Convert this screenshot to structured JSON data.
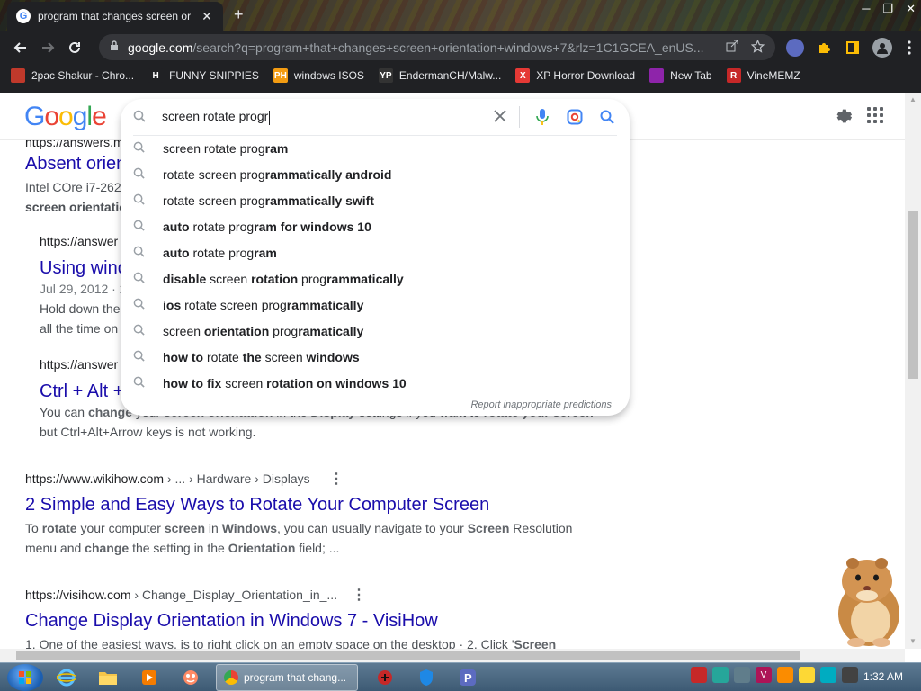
{
  "tab": {
    "title": "program that changes screen or",
    "close": "✕",
    "new_tab": "+"
  },
  "window_controls": {
    "minimize": "─",
    "maximize": "❐",
    "close": "✕"
  },
  "omnibox": {
    "host": "google.com",
    "path": "/search?q=program+that+changes+screen+orientation+windows+7&rlz=1C1GCEA_enUS..."
  },
  "bookmarks": [
    {
      "label": "2pac Shakur - Chro...",
      "icon": "2pac-bookmark-icon",
      "icon_text": "",
      "color": "#c0392b"
    },
    {
      "label": "FUNNY SNIPPIES",
      "icon": "h-icon",
      "icon_text": "H",
      "color": "#202124"
    },
    {
      "label": "windows ISOS",
      "icon": "ph-icon",
      "icon_text": "PH",
      "color": "#f39c12"
    },
    {
      "label": "EndermanCH/Malw...",
      "icon": "yp-icon",
      "icon_text": "YP",
      "color": "#333333"
    },
    {
      "label": "XP Horror Download",
      "icon": "x-icon",
      "icon_text": "X",
      "color": "#e53935"
    },
    {
      "label": "New Tab",
      "icon": "newtab-icon",
      "icon_text": "",
      "color": "#8e24aa"
    },
    {
      "label": "VineMEMZ",
      "icon": "r-icon",
      "icon_text": "R",
      "color": "#c62828"
    }
  ],
  "logo": [
    "G",
    "o",
    "o",
    "g",
    "l",
    "e"
  ],
  "search": {
    "value": "screen rotate progr",
    "report": "Report inappropriate predictions",
    "suggestions": [
      {
        "a": "screen rotate prog",
        "b": "ram",
        "c": "",
        "d": ""
      },
      {
        "a": "rotate screen prog",
        "b": "rammatically android",
        "c": "",
        "d": ""
      },
      {
        "a": "rotate screen prog",
        "b": "rammatically swift",
        "c": "",
        "d": ""
      },
      {
        "a": "",
        "b": "auto",
        "c": " rotate prog",
        "d": "ram for windows 10"
      },
      {
        "a": "",
        "b": "auto",
        "c": " rotate prog",
        "d": "ram"
      },
      {
        "a": "",
        "b": "disable",
        "c": " screen ",
        "d": "rotation",
        "e": " prog",
        "f": "rammatically"
      },
      {
        "a": "",
        "b": "ios",
        "c": " rotate screen prog",
        "d": "rammatically"
      },
      {
        "a": "screen ",
        "b": "orientation",
        "c": " prog",
        "d": "ramatically"
      },
      {
        "a": "",
        "b": "how to",
        "c": " rotate ",
        "d": "the",
        "e": " screen ",
        "f": "windows"
      },
      {
        "a": "",
        "b": "how to fix",
        "c": " screen ",
        "d": "rotation on windows 10"
      }
    ]
  },
  "results": {
    "r1_cite_partial": "https://answers.m",
    "r1_title": "Absent orien",
    "r1_snip1": "Intel COre i7-2620",
    "r1_snip2": "screen orientatio",
    "r2_cite": "https://answer",
    "r2_title": "Using wind",
    "r2_date": "Jul 29, 2012 · 2",
    "r2_snip1": "Hold down the",
    "r2_snip2": "all the time on",
    "r3_cite": "https://answer",
    "r3_title": "Ctrl + Alt +",
    "r3_snip1_pre": "You can ",
    "r3_snip1_b": "change",
    "r3_snip1_rest": " your ",
    "r3_snip1_b2": "screen orientation",
    "r3_snip1_rest2": " in the ",
    "r3_snip1_b3": "Display",
    "r3_snip1_rest3": " settings if you want to ",
    "r3_snip1_b4": "rotate your screen",
    "r3_snip2": "but Ctrl+Alt+Arrow keys is not working.",
    "r4_cite_host": "https://www.wikihow.com",
    "r4_cite_path": " › ... › Hardware › Displays",
    "r4_title": "2 Simple and Easy Ways to Rotate Your Computer Screen",
    "r4_s1": "To ",
    "r4_s1b": "rotate",
    "r4_s2": " your computer ",
    "r4_s2b": "screen",
    "r4_s3": " in ",
    "r4_s3b": "Windows",
    "r4_s4": ", you can usually navigate to your ",
    "r4_s4b": "Screen",
    "r4_s5": " Resolution",
    "r4_l2a": "menu and ",
    "r4_l2b": "change",
    "r4_l2c": " the setting in the ",
    "r4_l2d": "Orientation",
    "r4_l2e": " field; ...",
    "r5_cite_host": "https://visihow.com",
    "r5_cite_path": " › Change_Display_Orientation_in_...",
    "r5_title": "Change Display Orientation in Windows 7 - VisiHow",
    "r5_snip_pre": "1. One of the easiest ways, is to right click on an empty space on the desktop · 2. Click '",
    "r5_snip_b": "Screen",
    "kebab": "⋮"
  },
  "taskbar": {
    "active_label": "program that chang...",
    "clock": "1:32 AM"
  }
}
